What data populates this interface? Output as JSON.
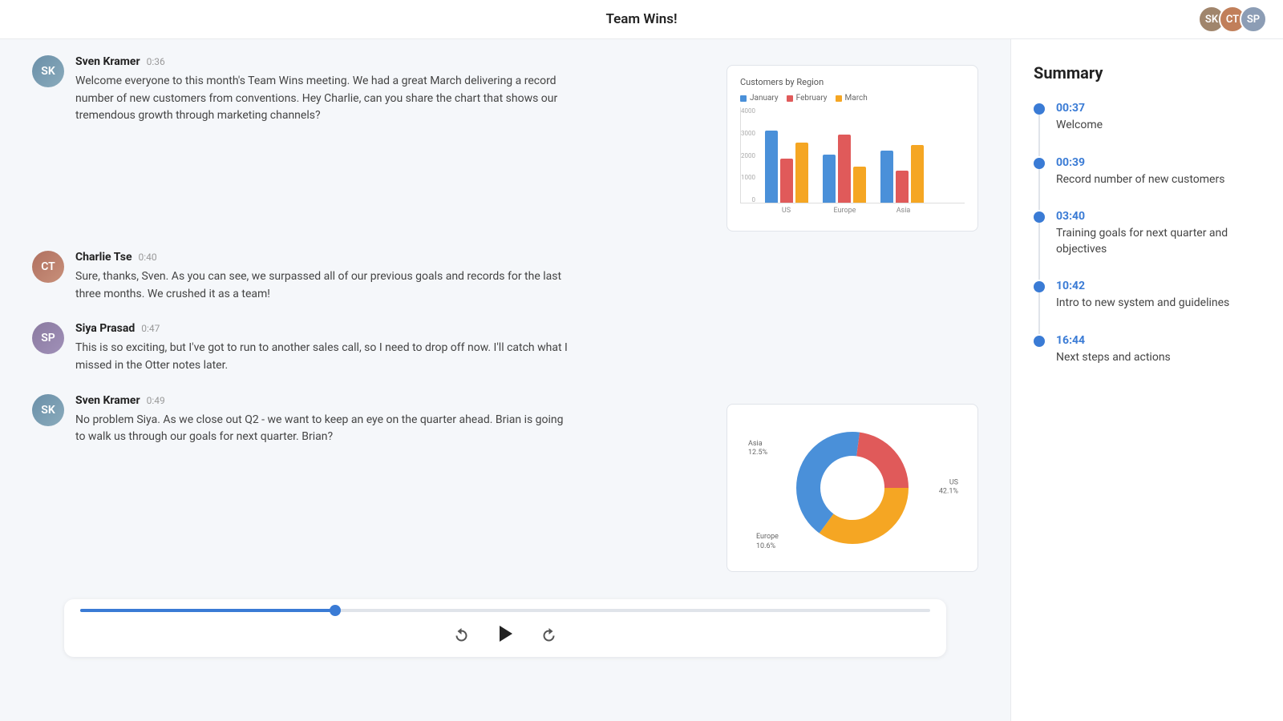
{
  "header": {
    "title": "Team Wins!"
  },
  "avatars": [
    {
      "initials": "SK",
      "class": "av1"
    },
    {
      "initials": "CT",
      "class": "av2"
    },
    {
      "initials": "SP",
      "class": "av3"
    }
  ],
  "messages": [
    {
      "id": "msg1",
      "speaker": "Sven Kramer",
      "time": "0:36",
      "avatarClass": "sven-av",
      "initials": "SK",
      "text": "Welcome everyone to this month's Team Wins meeting. We had a great March delivering a record number of new customers from conventions. Hey Charlie, can you share the chart that shows our tremendous growth through marketing channels?",
      "chart": "bar"
    },
    {
      "id": "msg2",
      "speaker": "Charlie Tse",
      "time": "0:40",
      "avatarClass": "charlie-av",
      "initials": "CT",
      "text": "Sure, thanks, Sven. As you can see, we surpassed all of our previous goals and records for the last three months. We crushed it as a team!",
      "chart": null
    },
    {
      "id": "msg3",
      "speaker": "Siya Prasad",
      "time": "0:47",
      "avatarClass": "siya-av",
      "initials": "SP",
      "text": "This is so exciting, but I've got to run to another sales call, so I need to drop off now. I'll catch what I missed in the Otter notes later.",
      "chart": null
    },
    {
      "id": "msg4",
      "speaker": "Sven Kramer",
      "time": "0:49",
      "avatarClass": "sven-av",
      "initials": "SK",
      "text": "No problem Siya. As we close out Q2 - we want to keep an eye on the quarter ahead. Brian is going to walk us through our goals for next quarter. Brian?",
      "chart": "donut"
    }
  ],
  "barChart": {
    "title": "Customers by Region",
    "legend": [
      {
        "label": "January",
        "color": "#4a90d9"
      },
      {
        "label": "February",
        "color": "#e05a5a"
      },
      {
        "label": "March",
        "color": "#f5a623"
      }
    ],
    "groups": [
      {
        "label": "US",
        "jan": 90,
        "feb": 55,
        "mar": 75
      },
      {
        "label": "Europe",
        "jan": 60,
        "feb": 85,
        "mar": 45
      },
      {
        "label": "Asia",
        "jan": 65,
        "feb": 40,
        "mar": 72
      }
    ],
    "yLabels": [
      "4000",
      "3000",
      "2000",
      "1000",
      "0"
    ]
  },
  "donutChart": {
    "segments": [
      {
        "label": "Asia\n12.5%",
        "color": "#f5a623",
        "pct": 35
      },
      {
        "label": "US\n42.1%",
        "color": "#4a90d9",
        "pct": 42
      },
      {
        "label": "Europe\n10.6%",
        "color": "#e05a5a",
        "pct": 23
      }
    ]
  },
  "player": {
    "progress": 30,
    "rewindLabel": "⟲",
    "playLabel": "▶",
    "forwardLabel": "⟳"
  },
  "summary": {
    "title": "Summary",
    "items": [
      {
        "time": "00:37",
        "description": "Welcome"
      },
      {
        "time": "00:39",
        "description": "Record number of new customers"
      },
      {
        "time": "03:40",
        "description": "Training goals for next quarter and objectives"
      },
      {
        "time": "10:42",
        "description": "Intro to new system and guidelines"
      },
      {
        "time": "16:44",
        "description": "Next steps and actions"
      }
    ]
  }
}
